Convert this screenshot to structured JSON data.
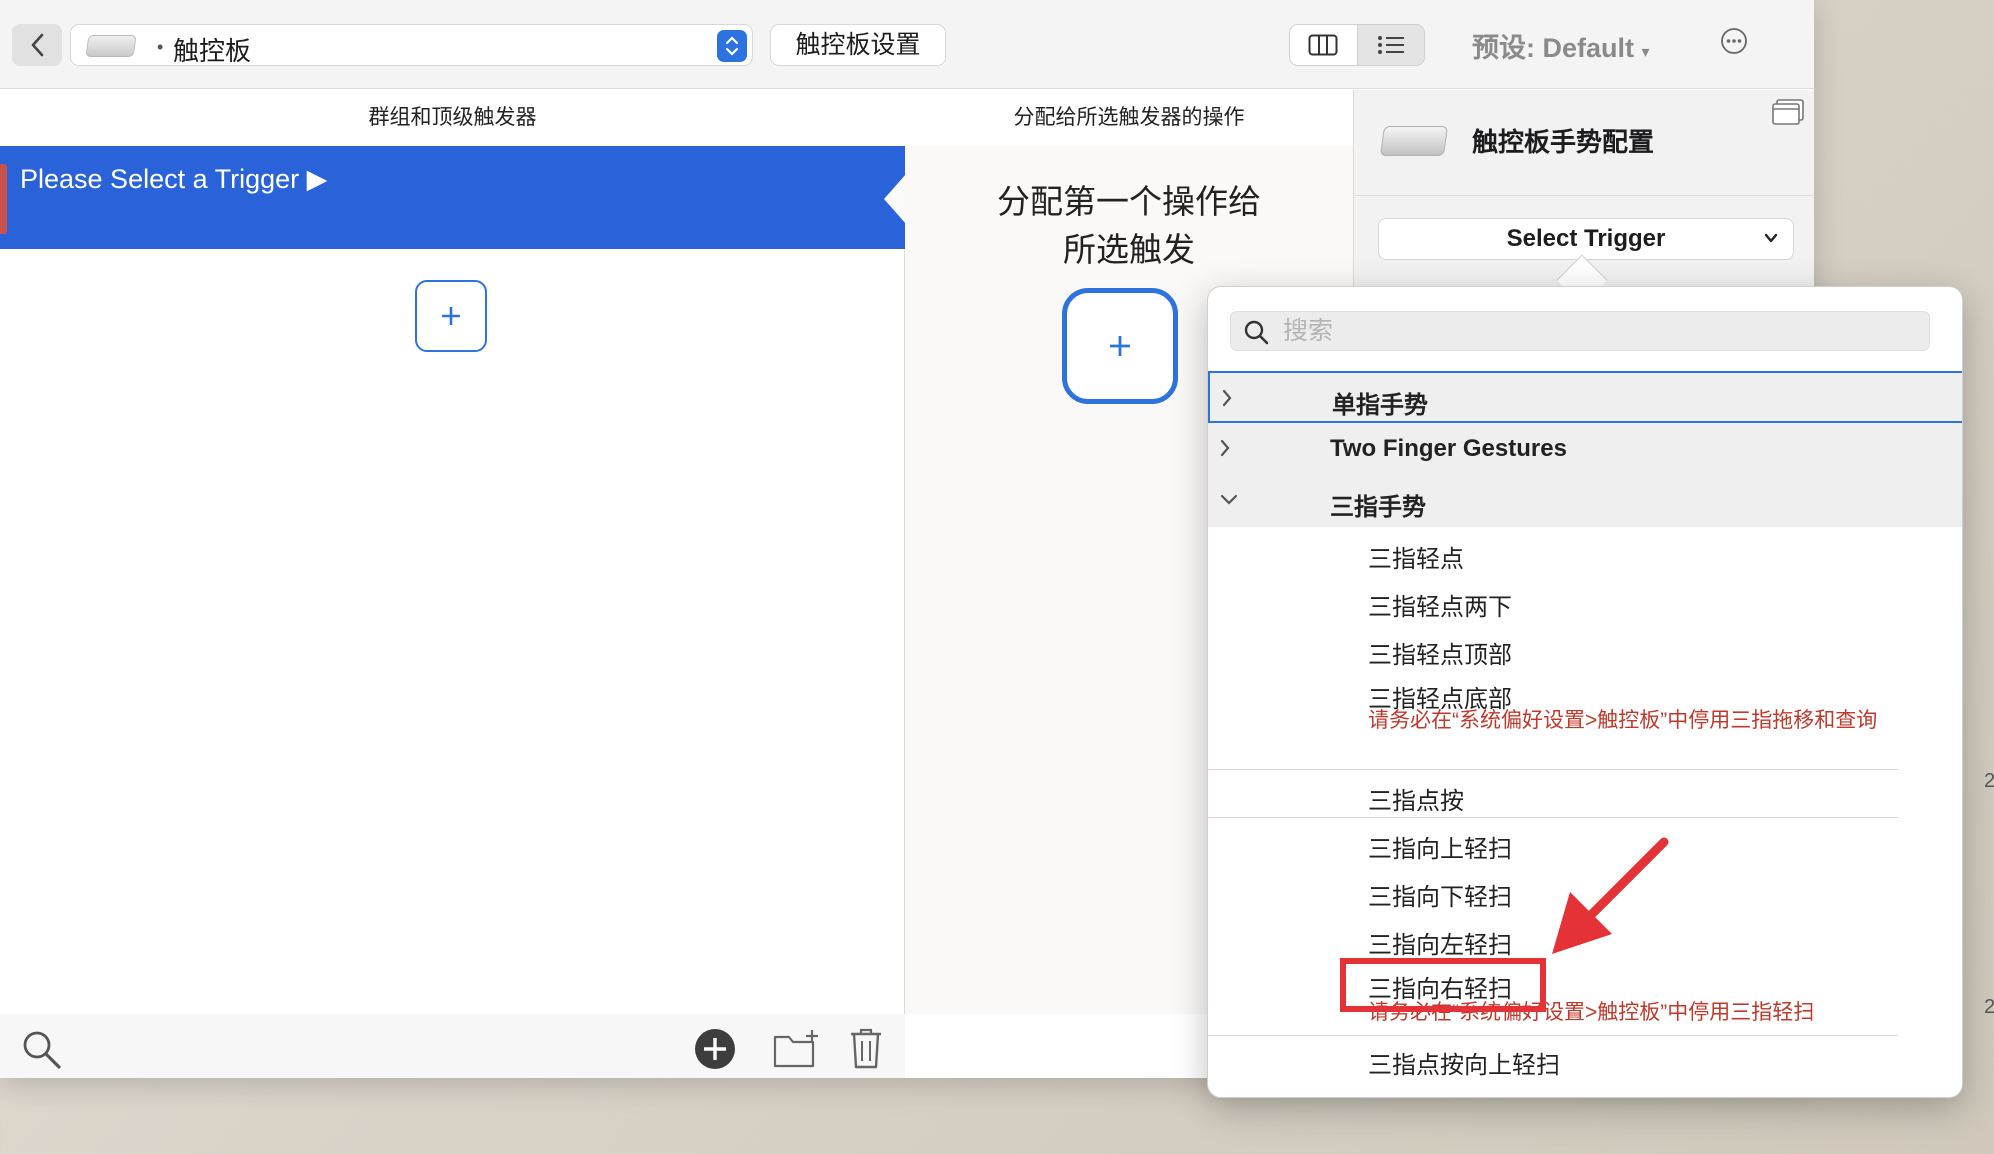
{
  "toolbar": {
    "path_separator": "•",
    "device_label": "触控板",
    "settings_button": "触控板设置",
    "preset_label": "预设: Default",
    "preset_arrow": "▾"
  },
  "columns": {
    "left_header": "群组和顶级触发器",
    "middle_header": "分配给所选触发器的操作"
  },
  "left": {
    "selected_row_label": "Please Select a Trigger ▶"
  },
  "middle": {
    "prompt_line1": "分配第一个操作给",
    "prompt_line2": "所选触发"
  },
  "right": {
    "title": "触控板手势配置",
    "select_trigger": "Select Trigger"
  },
  "popover": {
    "search_placeholder": "搜索",
    "groups": [
      "单指手势",
      "Two Finger Gestures",
      "三指手势"
    ],
    "items": [
      "三指轻点",
      "三指轻点两下",
      "三指轻点顶部",
      "三指轻点底部",
      "三指点按",
      "三指向上轻扫",
      "三指向下轻扫",
      "三指向左轻扫",
      "三指向右轻扫",
      "三指点按向上轻扫"
    ],
    "note_bottom_tap": "请务必在“系统偏好设置>触控板”中停用三指拖移和查询",
    "note_swipe": "请务必在“系统偏好设置>触控板”中停用三指轻扫"
  },
  "edge_marks": [
    "2",
    "2"
  ],
  "colors": {
    "accent": "#2c73e0",
    "selection": "#2a63d9",
    "warning_text": "#c0392b",
    "annotation": "#e53236"
  }
}
